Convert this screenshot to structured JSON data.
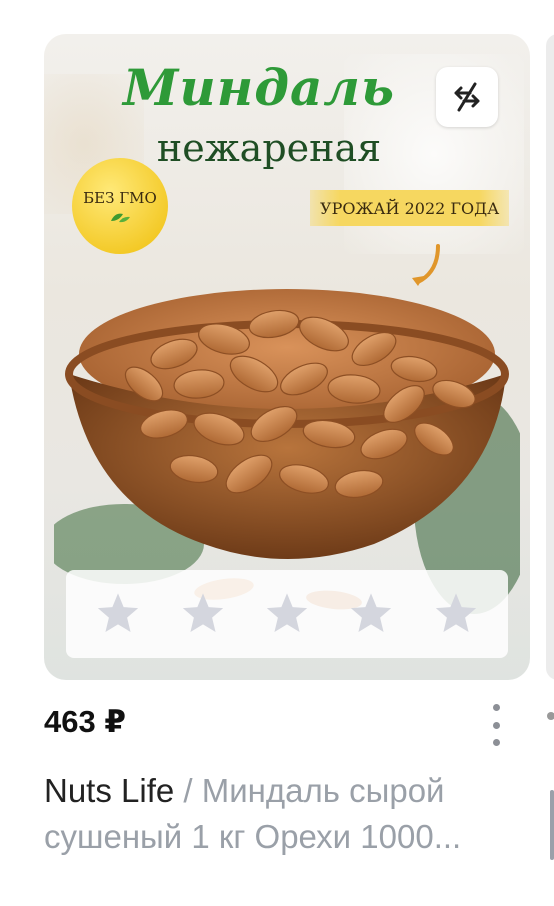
{
  "product": {
    "banner": {
      "title": "Миндаль",
      "subtitle": "нежареная",
      "badge_gmo": "БЕЗ ГМО",
      "harvest": "УРОЖАЙ 2022 ГОДА"
    },
    "rating": {
      "stars_filled": 0,
      "stars_total": 5
    },
    "price": "463 ₽",
    "brand": "Nuts Life",
    "separator": " / ",
    "name": "Миндаль сырой сушеный 1 кг Орехи 1000..."
  },
  "colors": {
    "title_green": "#2e9a38",
    "subtitle_green": "#1f4e24",
    "badge_yellow": "#f3c926",
    "star_gray": "#d4d6de",
    "desc_gray": "#9aa0a8"
  },
  "icons": [
    "compare-icon",
    "leaf-icon",
    "arrow-icon",
    "star-icon",
    "more-vertical-icon"
  ]
}
